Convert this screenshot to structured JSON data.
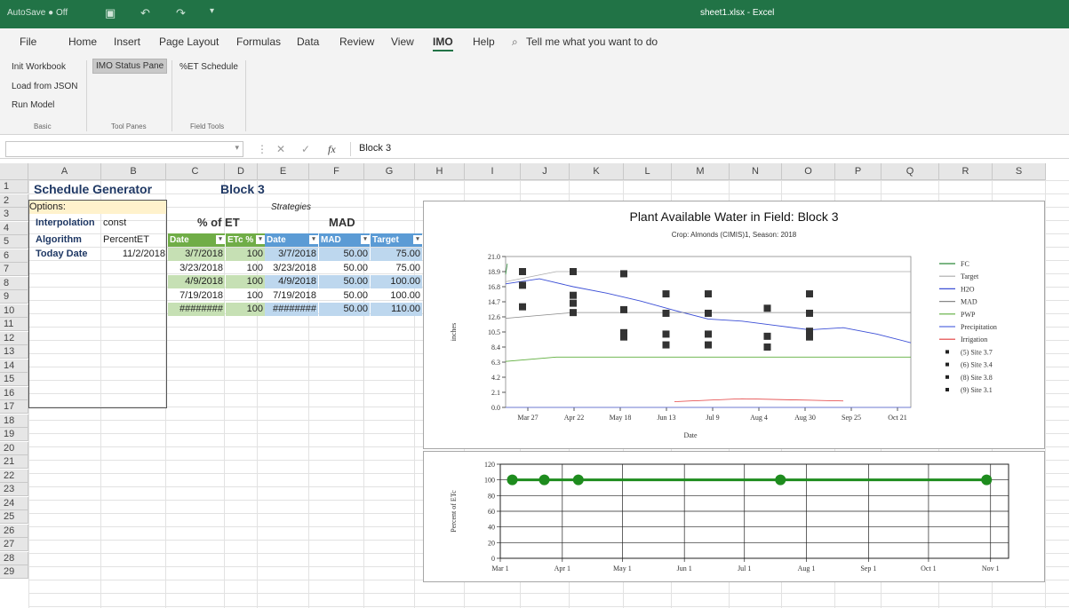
{
  "titlebar": {
    "autosave": "AutoSave  ● Off",
    "title": "sheet1.xlsx  -  Excel"
  },
  "menu": [
    "File",
    "Home",
    "Insert",
    "Page Layout",
    "Formulas",
    "Data",
    "Review",
    "View",
    "IMO",
    "Help",
    "Tell me what you want to do"
  ],
  "ribbon": {
    "init_workbook": "Init Workbook",
    "load_json": "Load from JSON",
    "run_model": "Run Model",
    "status_pane": "IMO Status Pane",
    "et_schedule": "%ET Schedule",
    "group_basic": "Basic",
    "group_tool_panes": "Tool Panes",
    "group_field_tools": "Field Tools"
  },
  "formula_bar": {
    "value": "Block 3"
  },
  "columns": [
    "A",
    "B",
    "C",
    "D",
    "E",
    "F",
    "G",
    "H",
    "I",
    "J",
    "K",
    "L",
    "M",
    "N",
    "O",
    "P",
    "Q",
    "R",
    "S"
  ],
  "rows": [
    "1",
    "2",
    "3",
    "4",
    "5",
    "6",
    "7",
    "8",
    "9",
    "10",
    "11",
    "12",
    "13",
    "14",
    "15",
    "16",
    "17",
    "18",
    "19",
    "20",
    "21",
    "22",
    "23",
    "24",
    "25",
    "26",
    "27",
    "28",
    "29"
  ],
  "sheet": {
    "title": "Schedule Generator",
    "block": "Block 3",
    "options_label": "Options:",
    "strategies": "Strategies",
    "interpolation_label": "Interpolation",
    "interpolation_value": "const",
    "pct_et": "% of ET",
    "mad_title": "MAD",
    "algorithm_label": "Algorithm",
    "algorithm_value": "PercentET",
    "today_label": "Today Date",
    "today_value": "11/2/2018",
    "hdr_date": "Date",
    "hdr_etc": "ETc %",
    "hdr_date2": "Date",
    "hdr_mad": "MAD",
    "hdr_target": "Target",
    "et_rows": [
      {
        "date": "3/7/2018",
        "etc": "100"
      },
      {
        "date": "3/23/2018",
        "etc": "100"
      },
      {
        "date": "4/9/2018",
        "etc": "100"
      },
      {
        "date": "7/19/2018",
        "etc": "100"
      },
      {
        "date": "########",
        "etc": "100"
      }
    ],
    "mad_rows": [
      {
        "date": "3/7/2018",
        "mad": "50.00",
        "target": "75.00"
      },
      {
        "date": "3/23/2018",
        "mad": "50.00",
        "target": "75.00"
      },
      {
        "date": "4/9/2018",
        "mad": "50.00",
        "target": "100.00"
      },
      {
        "date": "7/19/2018",
        "mad": "50.00",
        "target": "100.00"
      },
      {
        "date": "########",
        "mad": "50.00",
        "target": "110.00"
      }
    ]
  },
  "chart_data": [
    {
      "type": "line",
      "title": "Plant Available Water in Field: Block 3",
      "subtitle": "Crop: Almonds (CIMIS)1, Season: 2018",
      "xlabel": "Date",
      "ylabel": "inches",
      "x_ticks": [
        "Mar 27",
        "Apr 22",
        "May 18",
        "Jun 13",
        "Jul 9",
        "Aug 4",
        "Aug 30",
        "Sep 25",
        "Oct 21"
      ],
      "y_ticks": [
        "21.0",
        "18.9",
        "16.8",
        "14.7",
        "12.6",
        "10.5",
        "8.4",
        "6.3",
        "4.2",
        "2.1",
        "0.0"
      ],
      "ylim": [
        0,
        21
      ],
      "legend_position": "right",
      "series": [
        {
          "name": "FC",
          "color": "#2e8b3a",
          "x": [
            0,
            1
          ],
          "y": [
            18.5,
            20.0
          ]
        },
        {
          "name": "Target",
          "color": "#aaaaaa",
          "x": [
            0,
            30,
            200,
            240
          ],
          "y": [
            17.5,
            18.9,
            18.9,
            18.9
          ]
        },
        {
          "name": "H2O",
          "color": "#3c4fd6",
          "x": [
            0,
            20,
            40,
            60,
            80,
            100,
            120,
            140,
            160,
            180,
            200,
            220,
            240
          ],
          "y": [
            17.2,
            17.9,
            16.8,
            15.9,
            14.8,
            13.5,
            12.3,
            12.0,
            11.4,
            10.8,
            11.1,
            10.2,
            9.0
          ]
        },
        {
          "name": "MAD",
          "color": "#888888",
          "x": [
            0,
            40,
            240
          ],
          "y": [
            12.4,
            13.2,
            13.2
          ]
        },
        {
          "name": "PWP",
          "color": "#5fae3d",
          "x": [
            0,
            30,
            240
          ],
          "y": [
            6.4,
            7.0,
            7.0
          ]
        },
        {
          "name": "Precipitation",
          "color": "#5b6de0",
          "x": [
            0,
            240
          ],
          "y": [
            0.0,
            0.0
          ]
        },
        {
          "name": "Irrigation",
          "color": "#e33b3b",
          "x": [
            100,
            140,
            180,
            200
          ],
          "y": [
            0.8,
            1.2,
            1.0,
            0.9
          ]
        },
        {
          "name": "(5) Site 3.7",
          "color": "#222222",
          "x": [],
          "y": []
        },
        {
          "name": "(6) Site 3.4",
          "color": "#222222",
          "x": [],
          "y": []
        },
        {
          "name": "(8) Site 3.8",
          "color": "#222222",
          "x": [],
          "y": []
        },
        {
          "name": "(9) Site 3.1",
          "color": "#222222",
          "x": [],
          "y": []
        }
      ],
      "site_points": [
        {
          "x": 10,
          "y": 18.9
        },
        {
          "x": 10,
          "y": 17.0
        },
        {
          "x": 10,
          "y": 14.0
        },
        {
          "x": 40,
          "y": 18.9
        },
        {
          "x": 40,
          "y": 15.6
        },
        {
          "x": 40,
          "y": 14.5
        },
        {
          "x": 40,
          "y": 13.2
        },
        {
          "x": 70,
          "y": 18.6
        },
        {
          "x": 70,
          "y": 13.6
        },
        {
          "x": 70,
          "y": 10.4
        },
        {
          "x": 70,
          "y": 9.8
        },
        {
          "x": 95,
          "y": 15.8
        },
        {
          "x": 95,
          "y": 13.1
        },
        {
          "x": 95,
          "y": 10.2
        },
        {
          "x": 95,
          "y": 8.7
        },
        {
          "x": 120,
          "y": 15.8
        },
        {
          "x": 120,
          "y": 13.1
        },
        {
          "x": 120,
          "y": 10.2
        },
        {
          "x": 120,
          "y": 8.7
        },
        {
          "x": 155,
          "y": 13.8
        },
        {
          "x": 155,
          "y": 9.9
        },
        {
          "x": 155,
          "y": 8.4
        },
        {
          "x": 180,
          "y": 15.8
        },
        {
          "x": 180,
          "y": 13.1
        },
        {
          "x": 180,
          "y": 10.6
        },
        {
          "x": 180,
          "y": 9.8
        }
      ]
    },
    {
      "type": "line",
      "title": "",
      "xlabel": "",
      "ylabel": "Percent of ETc",
      "x_ticks": [
        "Mar 1",
        "Apr 1",
        "May 1",
        "Jun 1",
        "Jul 1",
        "Aug 1",
        "Sep 1",
        "Oct 1",
        "Nov 1"
      ],
      "y_ticks": [
        "120",
        "100",
        "80",
        "60",
        "40",
        "20",
        "0"
      ],
      "ylim": [
        0,
        120
      ],
      "series": [
        {
          "name": "",
          "color": "#1e8c1e",
          "x": [
            "3/7/2018",
            "3/23/2018",
            "4/9/2018",
            "7/19/2018",
            "10/30/2018"
          ],
          "y": [
            100,
            100,
            100,
            100,
            100
          ]
        }
      ]
    }
  ]
}
